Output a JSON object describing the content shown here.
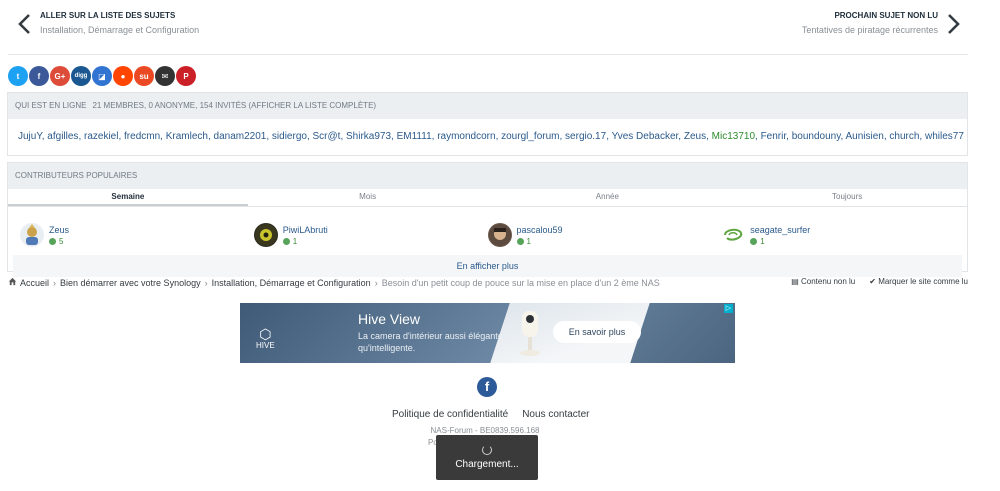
{
  "topnav": {
    "prev_title": "ALLER SUR LA LISTE DES SUJETS",
    "prev_sub": "Installation, Démarrage et Configuration",
    "next_title": "PROCHAIN SUJET NON LU",
    "next_sub": "Tentatives de piratage récurrentes"
  },
  "share": [
    {
      "name": "twitter",
      "glyph": "t",
      "color": "#1da1f2"
    },
    {
      "name": "facebook",
      "glyph": "f",
      "color": "#3b5998"
    },
    {
      "name": "google-plus",
      "glyph": "G+",
      "color": "#dd4b39"
    },
    {
      "name": "digg",
      "glyph": "digg",
      "color": "#1b5891"
    },
    {
      "name": "delicious",
      "glyph": "◪",
      "color": "#3274d1"
    },
    {
      "name": "reddit",
      "glyph": "●",
      "color": "#ff4500"
    },
    {
      "name": "stumbleupon",
      "glyph": "su",
      "color": "#eb4924"
    },
    {
      "name": "email",
      "glyph": "✉",
      "color": "#333333"
    },
    {
      "name": "pinterest",
      "glyph": "P",
      "color": "#cb2027"
    }
  ],
  "online": {
    "header": "QUI EST EN LIGNE",
    "count": "21 MEMBRES, 0 ANONYME, 154 INVITÉS (AFFICHER LA LISTE COMPLÈTE)",
    "members": [
      "JujuY",
      "afgilles",
      "razekiel",
      "fredcmn",
      "Kramlech",
      "danam2201",
      "sidiergo",
      "Scr@t",
      "Shirka973",
      "EM1111",
      "raymondcorn",
      "zourgl_forum",
      "sergio.17",
      "Yves Debacker",
      "Zeus",
      "Mic13710",
      "Fenrir",
      "boundouny",
      "Aunisien",
      "church",
      "whiles77"
    ]
  },
  "contrib": {
    "header": "CONTRIBUTEURS POPULAIRES",
    "tabs": [
      "Semaine",
      "Mois",
      "Année",
      "Toujours"
    ],
    "leaders": [
      {
        "name": "Zeus",
        "rep": "5"
      },
      {
        "name": "PiwiLAbruti",
        "rep": "1"
      },
      {
        "name": "pascalou59",
        "rep": "1"
      },
      {
        "name": "seagate_surfer",
        "rep": "1"
      }
    ],
    "more": "En afficher plus"
  },
  "breadcrumb": {
    "home": "Accueil",
    "items": [
      "Bien démarrer avec votre Synology",
      "Installation, Démarrage et Configuration"
    ],
    "current": "Besoin d'un petit coup de pouce sur la mise en place d'un 2 ème NAS",
    "unread": "Contenu non lu",
    "mark_read": "Marquer le site comme lu"
  },
  "ad": {
    "brand": "HIVE",
    "title": "Hive View",
    "text": "La camera d'intérieur aussi élégante qu'intelligente.",
    "cta": "En savoir plus"
  },
  "footer": {
    "privacy": "Politique de confidentialité",
    "contact": "Nous contacter",
    "company": "NAS-Forum - BE0839.596.168",
    "powered_fragment_left": "Po",
    "powered_fragment_right": "y"
  },
  "loading": {
    "label": "Chargement..."
  }
}
